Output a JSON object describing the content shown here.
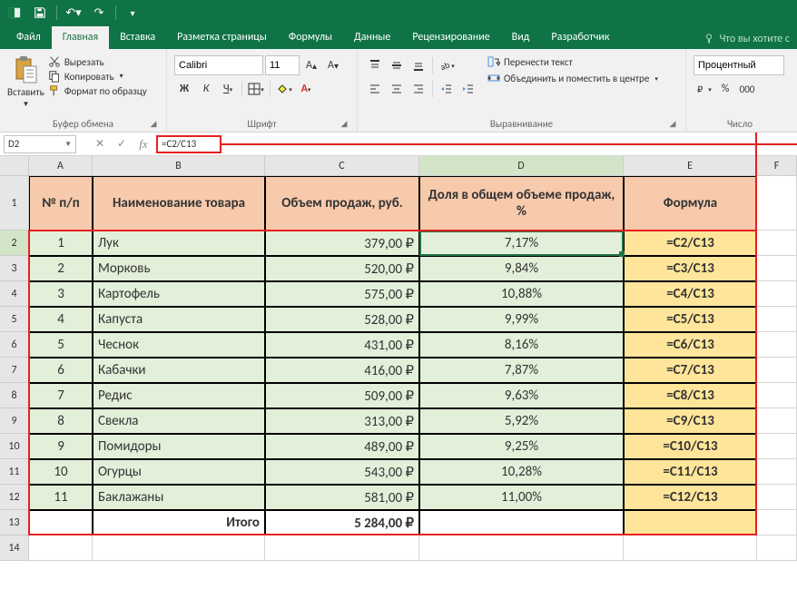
{
  "titlebar": {
    "save_icon": "save",
    "undo_icon": "undo",
    "redo_icon": "redo"
  },
  "tabs": {
    "file": "Файл",
    "home": "Главная",
    "insert": "Вставка",
    "layout": "Разметка страницы",
    "formulas": "Формулы",
    "data": "Данные",
    "review": "Рецензирование",
    "view": "Вид",
    "developer": "Разработчик",
    "tell_me": "Что вы хотите с"
  },
  "ribbon": {
    "clipboard": {
      "paste": "Вставить",
      "cut": "Вырезать",
      "copy": "Копировать",
      "format_painter": "Формат по образцу",
      "label": "Буфер обмена"
    },
    "font": {
      "name": "Calibri",
      "size": "11",
      "bold": "Ж",
      "italic": "К",
      "underline": "Ч",
      "label": "Шрифт"
    },
    "alignment": {
      "wrap": "Перенести текст",
      "merge": "Объединить и поместить в центре",
      "label": "Выравнивание"
    },
    "number": {
      "format": "Процентный",
      "label": "Число"
    }
  },
  "formula_bar": {
    "name_box": "D2",
    "formula": "=C2/C13"
  },
  "columns": [
    "A",
    "B",
    "C",
    "D",
    "E",
    "F"
  ],
  "row_labels": [
    "1",
    "2",
    "3",
    "4",
    "5",
    "6",
    "7",
    "8",
    "9",
    "10",
    "11",
    "12",
    "13",
    "14"
  ],
  "headers": {
    "a": "№ п/п",
    "b": "Наименование товара",
    "c": "Объем продаж, руб.",
    "d": "Доля в общем объеме продаж, %",
    "e": "Формула"
  },
  "rows": [
    {
      "n": "1",
      "name": "Лук",
      "vol": "379,00 ₽",
      "share": "7,17%",
      "f": "=C2/C13"
    },
    {
      "n": "2",
      "name": "Морковь",
      "vol": "520,00 ₽",
      "share": "9,84%",
      "f": "=C3/C13"
    },
    {
      "n": "3",
      "name": "Картофель",
      "vol": "575,00 ₽",
      "share": "10,88%",
      "f": "=C4/C13"
    },
    {
      "n": "4",
      "name": "Капуста",
      "vol": "528,00 ₽",
      "share": "9,99%",
      "f": "=C5/C13"
    },
    {
      "n": "5",
      "name": "Чеснок",
      "vol": "431,00 ₽",
      "share": "8,16%",
      "f": "=C6/C13"
    },
    {
      "n": "6",
      "name": "Кабачки",
      "vol": "416,00 ₽",
      "share": "7,87%",
      "f": "=C7/C13"
    },
    {
      "n": "7",
      "name": "Редис",
      "vol": "509,00 ₽",
      "share": "9,63%",
      "f": "=C8/C13"
    },
    {
      "n": "8",
      "name": "Свекла",
      "vol": "313,00 ₽",
      "share": "5,92%",
      "f": "=C9/C13"
    },
    {
      "n": "9",
      "name": "Помидоры",
      "vol": "489,00 ₽",
      "share": "9,25%",
      "f": "=C10/C13"
    },
    {
      "n": "10",
      "name": "Огурцы",
      "vol": "543,00 ₽",
      "share": "10,28%",
      "f": "=C11/C13"
    },
    {
      "n": "11",
      "name": "Баклажаны",
      "vol": "581,00 ₽",
      "share": "11,00%",
      "f": "=C12/C13"
    }
  ],
  "total": {
    "label": "Итого",
    "value": "5 284,00 ₽"
  }
}
